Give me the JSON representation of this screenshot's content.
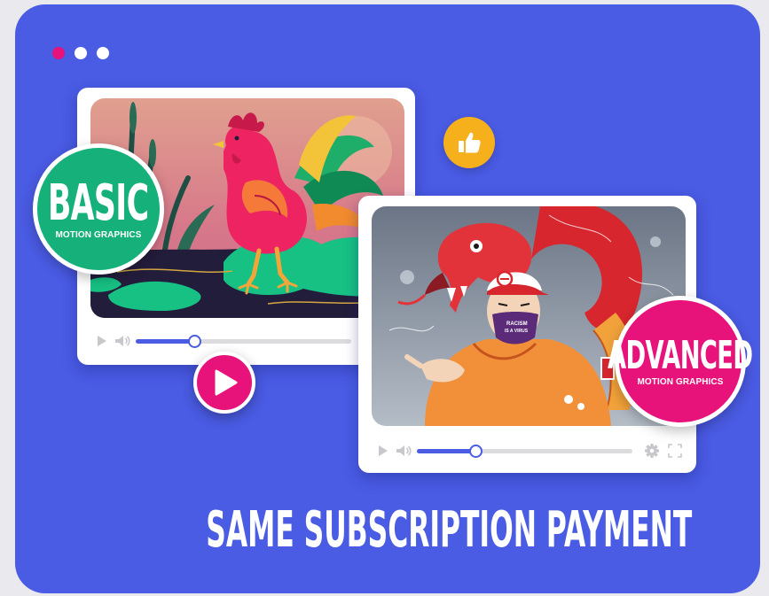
{
  "window": {
    "dots": [
      "#e8127b",
      "#ffffff",
      "#ffffff"
    ]
  },
  "colors": {
    "background": "#4a5be4",
    "basic_badge": "#16b07a",
    "advanced_badge": "#e8127b",
    "play_button": "#e8127b",
    "like_button": "#f6b01c",
    "progress": "#4a5be4"
  },
  "basic": {
    "title": "BASIC",
    "subtitle": "MOTION GRAPHICS",
    "illustration": "rooster-illustration",
    "progress": 0.27
  },
  "advanced": {
    "title": "ADVANCED",
    "subtitle": "MOTION GRAPHICS",
    "illustration": "serpent-and-masked-figure-illustration",
    "mask_text": "RACISM IS A VIRUS",
    "progress": 0.27
  },
  "player_icons": [
    "play-icon",
    "volume-icon",
    "gear-icon",
    "fullscreen-icon"
  ],
  "headline": "SAME SUBSCRIPTION PAYMENT"
}
